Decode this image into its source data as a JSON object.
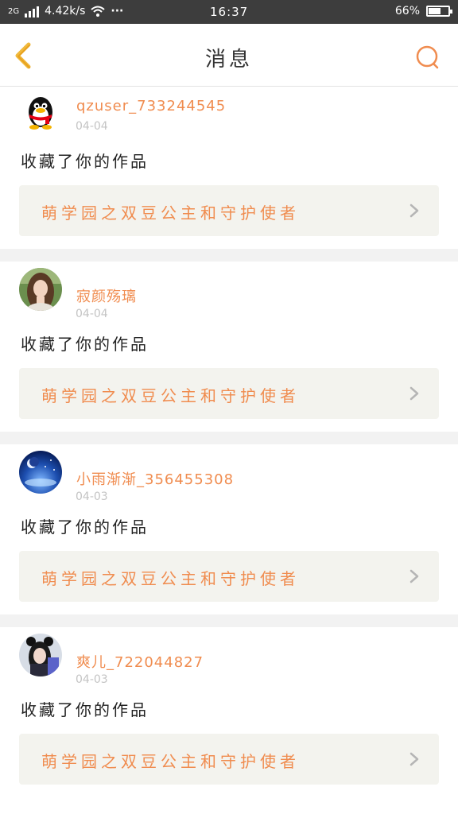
{
  "status_bar": {
    "network": "2G",
    "speed": "4.42k/s",
    "dots": "···",
    "time": "16:37",
    "battery": "66%",
    "battery_level": 0.66
  },
  "header": {
    "title": "消息",
    "back_icon": "chevron-left-icon",
    "search_icon": "search-icon"
  },
  "colors": {
    "accent": "#f08c4f",
    "back_icon": "#f0b93c",
    "work_box_bg": "#f3f3ee",
    "separator": "#f2f2f2"
  },
  "messages": [
    {
      "username": "qzuser_733244545",
      "date": "04-04",
      "action": "收藏了你的作品",
      "work_title": "萌学园之双豆公主和守护使者",
      "avatar": "penguin-avatar"
    },
    {
      "username": "寂颜殇璃",
      "date": "04-04",
      "action": "收藏了你的作品",
      "work_title": "萌学园之双豆公主和守护使者",
      "avatar": "girl-photo-avatar"
    },
    {
      "username": "小雨渐渐_356455308",
      "date": "04-03",
      "action": "收藏了你的作品",
      "work_title": "萌学园之双豆公主和守护使者",
      "avatar": "moon-night-avatar"
    },
    {
      "username": "爽儿_722044827",
      "date": "04-03",
      "action": "收藏了你的作品",
      "work_title": "萌学园之双豆公主和守护使者",
      "avatar": "girl-ears-avatar"
    }
  ]
}
